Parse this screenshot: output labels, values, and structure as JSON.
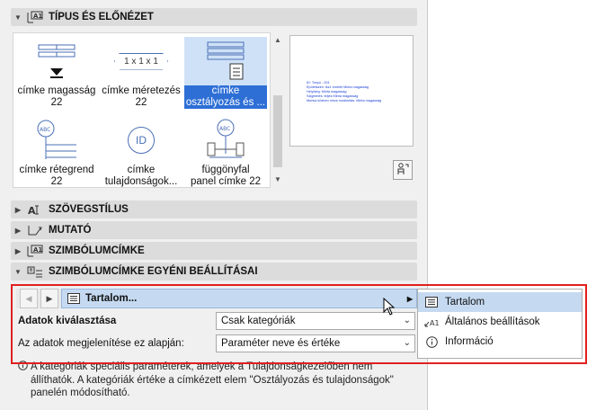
{
  "sections": {
    "tipus": "TÍPUS ÉS ELŐNÉZET",
    "szoveg": "SZÖVEGSTÍLUS",
    "mutato": "MUTATÓ",
    "szimbolum": "SZIMBÓLUMCÍMKE",
    "egyeni": "SZIMBÓLUMCÍMKE EGYÉNI BEÁLLÍTÁSAI"
  },
  "tiles": [
    {
      "line1": "címke magasság",
      "line2": "22"
    },
    {
      "line1": "címke méretezés",
      "line2": "22"
    },
    {
      "line1": "címke",
      "line2": "osztályozás és ..."
    },
    {
      "line1": "címke rétegrend",
      "line2": "22"
    },
    {
      "line1": "címke",
      "line2": "tulajdonságok..."
    },
    {
      "line1": "függönyfal",
      "line2": "panel címke 22"
    }
  ],
  "icon_text": {
    "dim": "1 x 1 x 1",
    "abc": "ABC",
    "id": "ID",
    "abc2": "ABC"
  },
  "preview": {
    "lines": [
      "ID: Tonyo - 001",
      "Épületszint: fsz1 emelet Minta magasság",
      "Helyiség: Minta magasság",
      "Szigetelés: teljes Minta magasság",
      "Munka közben nincs módosítás: Minta magasság"
    ]
  },
  "navigator": {
    "current": "Tartalom..."
  },
  "popup": {
    "items": [
      {
        "label": "Tartalom",
        "icon": "list-icon"
      },
      {
        "label": "Általános beállítások",
        "icon": "text-label-icon"
      },
      {
        "label": "Információ",
        "icon": "info-icon"
      }
    ]
  },
  "fields": {
    "adatok_label": "Adatok kiválasztása",
    "adatok_value": "Csak kategóriák",
    "megjelenites_label": "Az adatok megjelenítése ez alapján:",
    "megjelenites_value": "Paraméter neve és értéke"
  },
  "info_text": {
    "line1": "A kategóriák speciális paraméterek, amelyek a Tulajdonságkezelőben nem",
    "line2": "állíthatók. A kategóriák értéke a címkézett elem \"Osztályozás és tulajdonságok\"",
    "line3": "panelén módosítható."
  },
  "colors": {
    "selection": "#2e6fd6",
    "highlight": "#c5daf1",
    "annotation_box": "#e02020"
  }
}
